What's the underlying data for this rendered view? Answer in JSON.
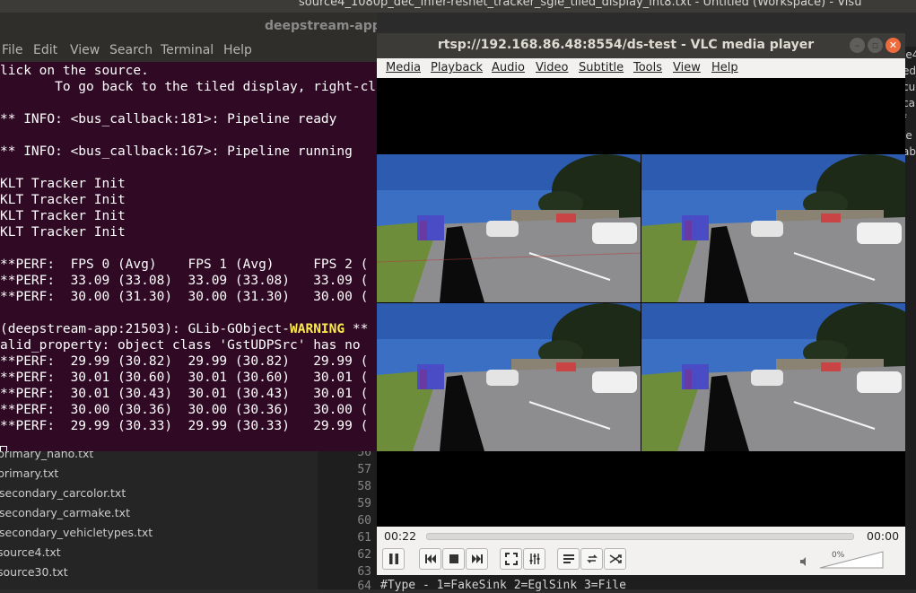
{
  "vscode": {
    "title": "source4_1080p_dec_infer-resnet_tracker_sgie_tiled_display_int8.txt - Untitled (Workspace) - Visu",
    "files": [
      "primary_nano.txt",
      "primary.txt",
      "secondary_carcolor.txt",
      "secondary_carmake.txt",
      "secondary_vehicletypes.txt",
      "source4.txt",
      "source30.txt"
    ],
    "line_numbers": [
      "56",
      "57",
      "58",
      "59",
      "60",
      "61",
      "62",
      "63",
      "64"
    ],
    "code_fragment": "#Type - 1=FakeSink 2=EglSink 3=File",
    "right_fragments": [
      "ie4",
      "ed_",
      "cu",
      "ca",
      "f",
      "le",
      "ab"
    ]
  },
  "terminal": {
    "title": "deepstream-app -c",
    "menu": [
      "File",
      "Edit",
      "View",
      "Search",
      "Terminal",
      "Help"
    ],
    "lines": [
      "lick on the source.",
      "       To go back to the tiled display, right-cl",
      "",
      "** INFO: <bus_callback:181>: Pipeline ready",
      "",
      "** INFO: <bus_callback:167>: Pipeline running",
      "",
      "KLT Tracker Init",
      "KLT Tracker Init",
      "KLT Tracker Init",
      "KLT Tracker Init",
      "",
      "**PERF:  FPS 0 (Avg)    FPS 1 (Avg)     FPS 2 (",
      "**PERF:  33.09 (33.08)  33.09 (33.08)   33.09 (",
      "**PERF:  30.00 (31.30)  30.00 (31.30)   30.00 (",
      "",
      "__WARNLINE__",
      "alid_property: object class 'GstUDPSrc' has no ",
      "**PERF:  29.99 (30.82)  29.99 (30.82)   29.99 (",
      "**PERF:  30.01 (30.60)  30.01 (30.60)   30.01 (",
      "**PERF:  30.01 (30.43)  30.01 (30.43)   30.01 (",
      "**PERF:  30.00 (30.36)  30.00 (30.36)   30.00 (",
      "**PERF:  29.99 (30.33)  29.99 (30.33)   29.99 ("
    ],
    "warning_prefix": "(deepstream-app:21503): GLib-GObject-",
    "warning_word": "WARNING",
    "warning_suffix": " **"
  },
  "vlc": {
    "title": "rtsp://192.168.86.48:8554/ds-test - VLC media player",
    "menu": [
      "Media",
      "Playback",
      "Audio",
      "Video",
      "Subtitle",
      "Tools",
      "View",
      "Help"
    ],
    "elapsed": "00:22",
    "total": "00:00",
    "progress": 0.0,
    "volume_label": "0%",
    "buttons": [
      "pause-icon",
      "previous-icon",
      "stop-icon",
      "next-icon",
      "fullscreen-icon",
      "extended-settings-icon",
      "playlist-icon",
      "loop-icon",
      "shuffle-icon"
    ]
  }
}
